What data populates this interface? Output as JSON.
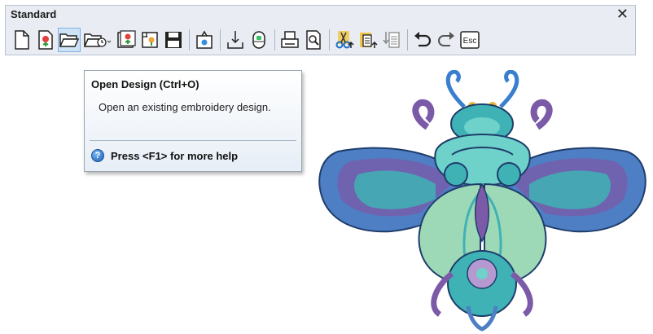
{
  "toolbar": {
    "title": "Standard",
    "close_glyph": "✕",
    "buttons": [
      {
        "name": "new-design",
        "icon": "document-icon"
      },
      {
        "name": "new-from-template",
        "icon": "flower-document-icon"
      },
      {
        "name": "open-design",
        "icon": "folder-open-icon",
        "active": true
      },
      {
        "name": "recent-designs",
        "icon": "folder-clock-icon"
      },
      {
        "name": "design-library",
        "icon": "flower-library-icon"
      },
      {
        "name": "insert-design",
        "icon": "insert-design-icon"
      },
      {
        "name": "save",
        "icon": "floppy-disk-icon"
      },
      {
        "name": "export",
        "icon": "export-icon"
      },
      {
        "name": "write-to-card",
        "icon": "write-down-icon"
      },
      {
        "name": "send-to-machine",
        "icon": "usb-icon"
      },
      {
        "name": "print",
        "icon": "printer-icon"
      },
      {
        "name": "print-preview",
        "icon": "preview-icon"
      },
      {
        "name": "cut",
        "icon": "scissors-icon"
      },
      {
        "name": "copy",
        "icon": "copy-icon"
      },
      {
        "name": "paste",
        "icon": "paste-icon"
      },
      {
        "name": "undo",
        "icon": "undo-icon"
      },
      {
        "name": "redo",
        "icon": "redo-icon"
      },
      {
        "name": "escape",
        "icon": "esc-icon",
        "label": "Esc"
      }
    ]
  },
  "tooltip": {
    "title": "Open Design (Ctrl+O)",
    "body": "Open an existing embroidery design.",
    "help_text": "Press <F1> for more help",
    "help_icon_glyph": "?"
  },
  "colors": {
    "teal": "#3fb2b5",
    "aqua": "#6ed2cb",
    "blue": "#4e7fc4",
    "purple": "#7b5aa8",
    "lilac": "#b59ad2",
    "mint": "#9ed9b7",
    "gold": "#e7b53a",
    "navy": "#1f3d6b"
  }
}
